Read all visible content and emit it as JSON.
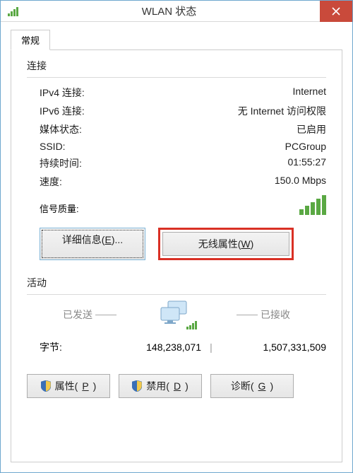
{
  "window": {
    "title": "WLAN 状态"
  },
  "tab": {
    "general": "常规"
  },
  "connection": {
    "section": "连接",
    "ipv4_label": "IPv4 连接:",
    "ipv4_value": "Internet",
    "ipv6_label": "IPv6 连接:",
    "ipv6_value": "无 Internet 访问权限",
    "media_label": "媒体状态:",
    "media_value": "已启用",
    "ssid_label": "SSID:",
    "ssid_value": "PCGroup",
    "duration_label": "持续时间:",
    "duration_value": "01:55:27",
    "speed_label": "速度:",
    "speed_value": "150.0 Mbps",
    "signal_label": "信号质量:"
  },
  "buttons": {
    "details_pre": "详细信息(",
    "details_key": "E",
    "details_post": ")...",
    "wireless_pre": "无线属性(",
    "wireless_key": "W",
    "wireless_post": ")",
    "properties_pre": "属性(",
    "properties_key": "P",
    "properties_post": ")",
    "disable_pre": "禁用(",
    "disable_key": "D",
    "disable_post": ")",
    "diagnose_pre": "诊断(",
    "diagnose_key": "G",
    "diagnose_post": ")"
  },
  "activity": {
    "section": "活动",
    "sent_label": "已发送",
    "received_label": "已接收",
    "bytes_label": "字节:",
    "bytes_sent": "148,238,071",
    "bytes_received": "1,507,331,509"
  }
}
